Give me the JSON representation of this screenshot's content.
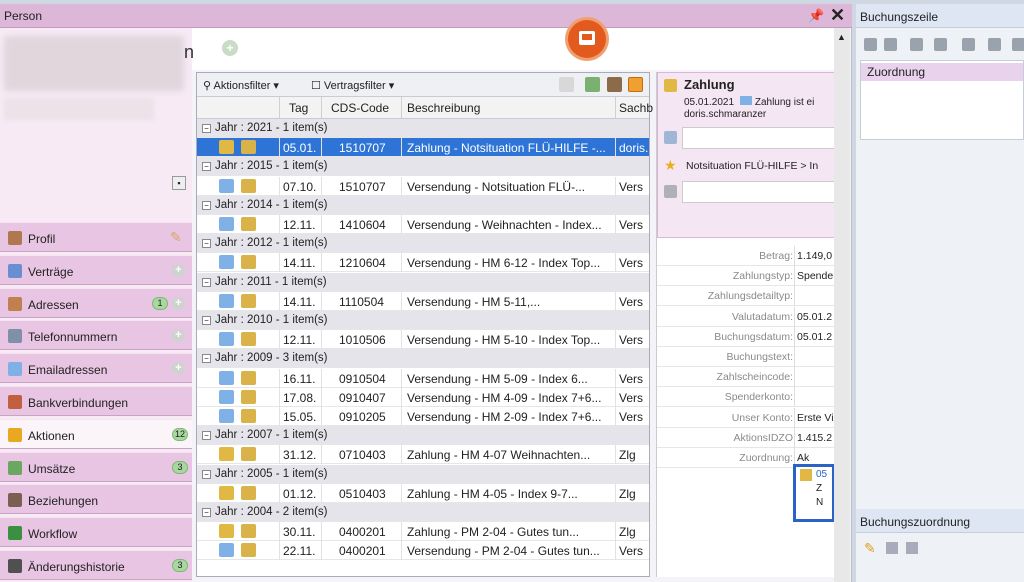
{
  "window_title": "Person",
  "person_name_fragment": "n",
  "sidebar": [
    {
      "label": "Profil",
      "icon": "person-icon",
      "extra": "edit"
    },
    {
      "label": "Verträge",
      "icon": "contract-icon",
      "extra": "add"
    },
    {
      "label": "Adressen",
      "icon": "home-icon",
      "count": "1",
      "extra": "add"
    },
    {
      "label": "Telefonnummern",
      "icon": "phone-icon",
      "extra": "add"
    },
    {
      "label": "Emailadressen",
      "icon": "mail-icon",
      "extra": "add"
    },
    {
      "label": "Bankverbindungen",
      "icon": "bank-icon"
    },
    {
      "label": "Aktionen",
      "icon": "lightning-icon",
      "count": "12",
      "active": true
    },
    {
      "label": "Umsätze",
      "icon": "money-icon",
      "count": "3"
    },
    {
      "label": "Beziehungen",
      "icon": "people-icon"
    },
    {
      "label": "Workflow",
      "icon": "workflow-icon"
    },
    {
      "label": "Änderungshistorie",
      "icon": "history-icon",
      "count": "3"
    }
  ],
  "toolbar": {
    "action_filter": "Aktionsfilter",
    "contract_filter": "Vertragsfilter"
  },
  "columns": {
    "tag": "Tag",
    "cds": "CDS-Code",
    "desc": "Beschreibung",
    "sach": "Sachb"
  },
  "rows": [
    {
      "group": "Jahr : 2021 - 1 item(s)"
    },
    {
      "tag": "05.01.",
      "cds": "1510707",
      "desc": "Zahlung - Notsituation FLÜ-HILFE -...",
      "sach": "doris.",
      "kind": "coin",
      "selected": true
    },
    {
      "group": "Jahr : 2015 - 1 item(s)"
    },
    {
      "tag": "07.10.",
      "cds": "1510707",
      "desc": "Versendung - Notsituation FLÜ-...",
      "sach": "Vers",
      "kind": "mail"
    },
    {
      "group": "Jahr : 2014 - 1 item(s)"
    },
    {
      "tag": "12.11.",
      "cds": "1410604",
      "desc": "Versendung - Weihnachten - Index...",
      "sach": "Vers",
      "kind": "mail"
    },
    {
      "group": "Jahr : 2012 - 1 item(s)"
    },
    {
      "tag": "14.11.",
      "cds": "1210604",
      "desc": "Versendung - HM 6-12 - Index Top...",
      "sach": "Vers",
      "kind": "mail"
    },
    {
      "group": "Jahr : 2011 - 1 item(s)"
    },
    {
      "tag": "14.11.",
      "cds": "1110504",
      "desc": "Versendung - HM 5-11,...",
      "sach": "Vers",
      "kind": "mail"
    },
    {
      "group": "Jahr : 2010 - 1 item(s)"
    },
    {
      "tag": "12.11.",
      "cds": "1010506",
      "desc": "Versendung - HM 5-10 - Index Top...",
      "sach": "Vers",
      "kind": "mail"
    },
    {
      "group": "Jahr : 2009 - 3 item(s)"
    },
    {
      "tag": "16.11.",
      "cds": "0910504",
      "desc": "Versendung - HM 5-09 - Index 6...",
      "sach": "Vers",
      "kind": "mail"
    },
    {
      "tag": "17.08.",
      "cds": "0910407",
      "desc": "Versendung - HM 4-09 - Index 7+6...",
      "sach": "Vers",
      "kind": "mail"
    },
    {
      "tag": "15.05.",
      "cds": "0910205",
      "desc": "Versendung - HM 2-09 - Index 7+6...",
      "sach": "Vers",
      "kind": "mail"
    },
    {
      "group": "Jahr : 2007 - 1 item(s)"
    },
    {
      "tag": "31.12.",
      "cds": "0710403",
      "desc": "Zahlung - HM 4-07 Weihnachten...",
      "sach": "Zlg",
      "kind": "coin"
    },
    {
      "group": "Jahr : 2005 - 1 item(s)"
    },
    {
      "tag": "01.12.",
      "cds": "0510403",
      "desc": "Zahlung - HM 4-05 - Index 9-7...",
      "sach": "Zlg",
      "kind": "coin"
    },
    {
      "group": "Jahr : 2004 - 2 item(s)"
    },
    {
      "tag": "30.11.",
      "cds": "0400201",
      "desc": "Zahlung - PM 2-04 - Gutes tun...",
      "sach": "Zlg",
      "kind": "coin"
    },
    {
      "tag": "22.11.",
      "cds": "0400201",
      "desc": "Versendung - PM 2-04 - Gutes tun...",
      "sach": "Vers",
      "kind": "mail"
    }
  ],
  "detail": {
    "title": "Zahlung",
    "date": "05.01.2021",
    "summary": "Zahlung ist ei",
    "user": "doris.schmaranzer",
    "campaign": "Notsituation FLÜ-HILFE > In",
    "fields": [
      {
        "k": "Betrag:",
        "v": "1.149,0"
      },
      {
        "k": "Zahlungstyp:",
        "v": "Spende"
      },
      {
        "k": "Zahlungsdetailtyp:",
        "v": ""
      },
      {
        "k": "Valutadatum:",
        "v": "05.01.2"
      },
      {
        "k": "Buchungsdatum:",
        "v": "05.01.2"
      },
      {
        "k": "Buchungstext:",
        "v": ""
      },
      {
        "k": "Zahlscheincode:",
        "v": ""
      },
      {
        "k": "Spenderkonto:",
        "v": ""
      },
      {
        "k": "Unser Konto:",
        "v": "Erste Vi"
      },
      {
        "k": "AktionsIDZO",
        "v": "1.415.2"
      },
      {
        "k": "Zuordnung:",
        "v": "Ak"
      }
    ],
    "zuordnung_block": {
      "l1": "05",
      "l2": "Z",
      "l3": "N"
    }
  },
  "right_panel": {
    "title": "Buchungszeile",
    "item": "Zuordnung",
    "bottom_title": "Buchungszuordnung"
  }
}
